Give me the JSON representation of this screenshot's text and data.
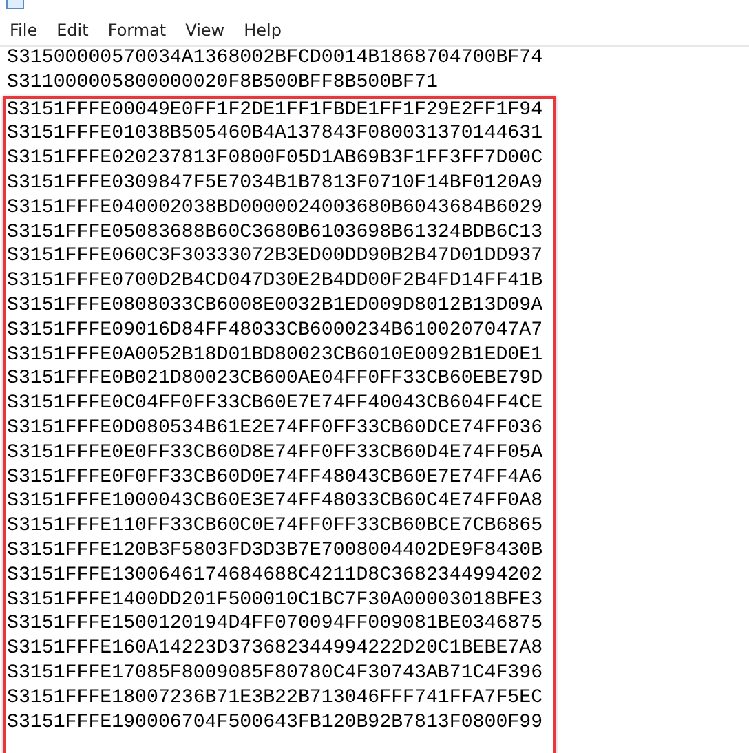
{
  "menu": [
    {
      "label": "File"
    },
    {
      "label": "Edit"
    },
    {
      "label": "Format"
    },
    {
      "label": "View"
    },
    {
      "label": "Help"
    }
  ],
  "editor": {
    "lines": [
      "S31500000570034A1368002BFCD0014B1868704700BF74",
      "S311000005800000020F8B500BFF8B500BF71"
    ],
    "highlighted_lines": [
      "S3151FFFE00049E0FF1F2DE1FF1FBDE1FF1F29E2FF1F94",
      "S3151FFFE01038B505460B4A137843F080031370144631",
      "S3151FFFE020237813F0800F05D1AB69B3F1FF3FF7D00C",
      "S3151FFFE0309847F5E7034B1B7813F0710F14BF0120A9",
      "S3151FFFE040002038BD0000024003680B6043684B6029",
      "S3151FFFE05083688B60C3680B6103698B61324BDB6C13",
      "S3151FFFE060C3F30333072B3ED00DD90B2B47D01DD937",
      "S3151FFFE0700D2B4CD047D30E2B4DD00F2B4FD14FF41B",
      "S3151FFFE0808033CB6008E0032B1ED009D8012B13D09A",
      "S3151FFFE09016D84FF48033CB6000234B6100207047A7",
      "S3151FFFE0A0052B18D01BD80023CB6010E0092B1ED0E1",
      "S3151FFFE0B021D80023CB600AE04FF0FF33CB60EBE79D",
      "S3151FFFE0C04FF0FF33CB60E7E74FF40043CB604FF4CE",
      "S3151FFFE0D080534B61E2E74FF0FF33CB60DCE74FF036",
      "S3151FFFE0E0FF33CB60D8E74FF0FF33CB60D4E74FF05A",
      "S3151FFFE0F0FF33CB60D0E74FF48043CB60E7E74FF4A6",
      "S3151FFFE1000043CB60E3E74FF48033CB60C4E74FF0A8",
      "S3151FFFE110FF33CB60C0E74FF0FF33CB60BCE7CB6865",
      "S3151FFFE120B3F5803FD3D3B7E7008004402DE9F8430B",
      "S3151FFFE1300646174684688C4211D8C3682344994202",
      "S3151FFFE1400DD201F500010C1BC7F30A00003018BFE3",
      "S3151FFFE1500120194D4FF070094FF009081BE0346875",
      "S3151FFFE160A14223D373682344994222D20C1BEBE7A8",
      "S3151FFFE17085F8009085F80780C4F30743AB71C4F396",
      "S3151FFFE18007236B71E3B22B713046FFF741FFA7F5EC",
      "S3151FFFE190006704F500643FB120B92B7813F0800F99"
    ]
  }
}
